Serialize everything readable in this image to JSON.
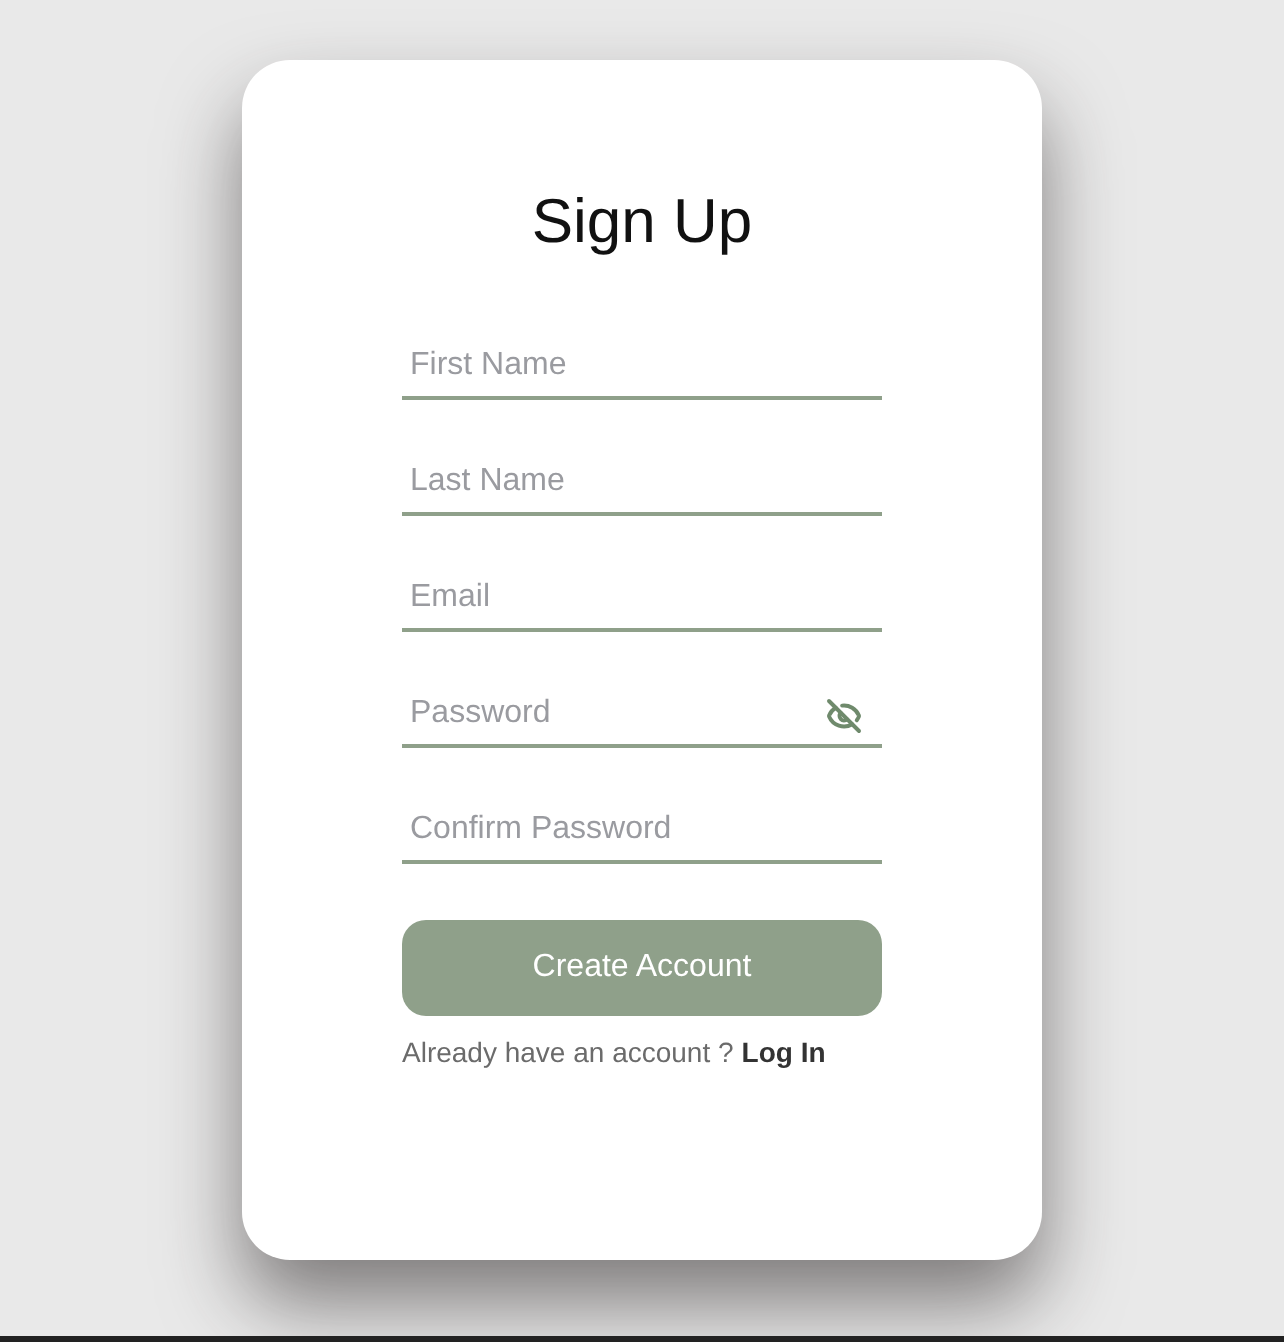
{
  "title": "Sign Up",
  "fields": [
    {
      "placeholder": "First Name",
      "kind": "text"
    },
    {
      "placeholder": "Last Name",
      "kind": "text"
    },
    {
      "placeholder": "Email",
      "kind": "text"
    },
    {
      "placeholder": "Password",
      "kind": "password"
    },
    {
      "placeholder": "Confirm Password",
      "kind": "text"
    }
  ],
  "submit": "Create Account",
  "footer": {
    "text": "Already have an account ?",
    "link": "Log In"
  }
}
